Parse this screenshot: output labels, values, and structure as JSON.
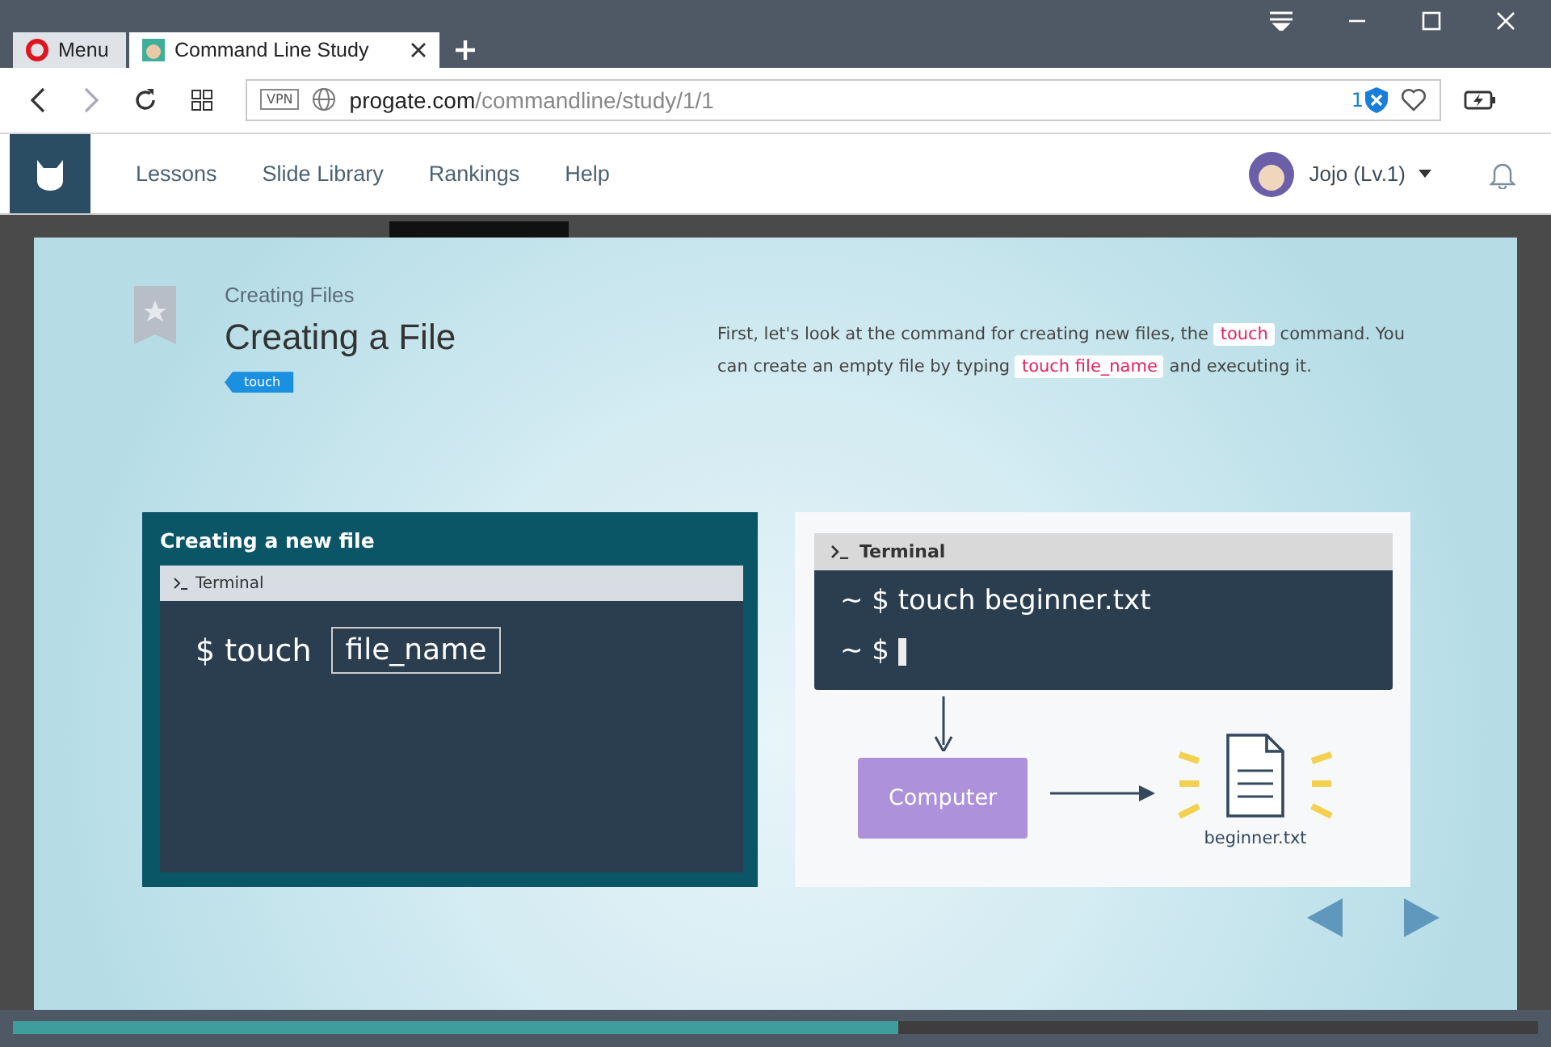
{
  "browser": {
    "tabs": [
      {
        "label": "Menu",
        "kind": "menu",
        "selected": false
      },
      {
        "label": "Command Line Study",
        "kind": "page",
        "selected": true
      }
    ],
    "address": {
      "vpn": "VPN",
      "host": "progate.com",
      "path": "/commandline/study/1/1",
      "blocked_count": "1"
    }
  },
  "nav": {
    "items": [
      {
        "label": "Lessons"
      },
      {
        "label": "Slide Library"
      },
      {
        "label": "Rankings"
      },
      {
        "label": "Help"
      }
    ],
    "user": "Jojo (Lv.1)"
  },
  "slide": {
    "section": "Creating Files",
    "title": "Creating a File",
    "tag": "touch",
    "description": [
      {
        "kind": "text",
        "text": "First, let's look at the command for creating new files, the"
      },
      {
        "kind": "code",
        "text": "touch"
      },
      {
        "kind": "text",
        "text": "command. You can create an empty file by typing"
      },
      {
        "kind": "code",
        "text": "touch file_name"
      },
      {
        "kind": "text",
        "text": "and executing it."
      }
    ],
    "left_panel": {
      "title": "Creating a new file",
      "terminal": "Terminal",
      "command": "$ touch",
      "argument": "file_name"
    },
    "right_panel": {
      "terminal": "Terminal",
      "lines": [
        "~ $ touch beginner.txt",
        "~ $"
      ],
      "computer": "Computer",
      "file": "beginner.txt"
    }
  },
  "progress": {
    "level": 0.58
  }
}
